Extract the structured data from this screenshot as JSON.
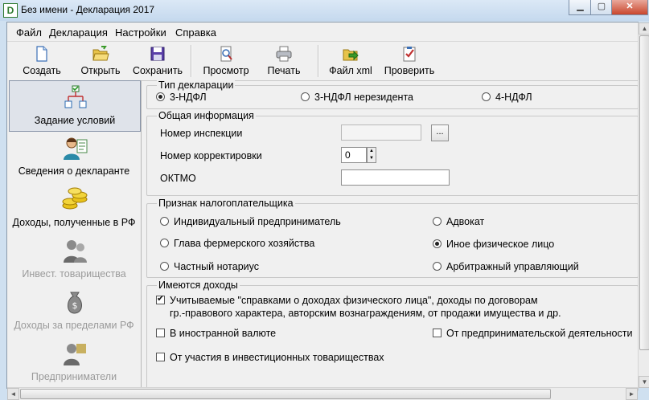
{
  "window": {
    "title": "Без имени - Декларация 2017",
    "app_icon_letter": "D",
    "controls": {
      "minimize": "▁",
      "maximize": "▢",
      "close": "✕"
    }
  },
  "menu": [
    "Файл",
    "Декларация",
    "Настройки",
    "Справка"
  ],
  "toolbar": [
    {
      "label": "Создать",
      "icon": "new-document-icon"
    },
    {
      "label": "Открыть",
      "icon": "open-folder-icon"
    },
    {
      "label": "Сохранить",
      "icon": "floppy-disk-icon"
    },
    {
      "label": "Просмотр",
      "icon": "preview-icon"
    },
    {
      "label": "Печать",
      "icon": "printer-icon"
    },
    {
      "label": "Файл xml",
      "icon": "xml-file-icon"
    },
    {
      "label": "Проверить",
      "icon": "checklist-icon"
    }
  ],
  "sidebar": [
    {
      "label": "Задание условий",
      "icon": "conditions-flowchart-icon",
      "selected": true,
      "disabled": false
    },
    {
      "label": "Сведения о декларанте",
      "icon": "person-card-icon",
      "selected": false,
      "disabled": false
    },
    {
      "label": "Доходы, полученные в РФ",
      "icon": "gold-coins-icon",
      "selected": false,
      "disabled": false
    },
    {
      "label": "Инвест. товарищества",
      "icon": "handshake-people-icon",
      "selected": false,
      "disabled": true
    },
    {
      "label": "Доходы за пределами РФ",
      "icon": "money-bag-icon",
      "selected": false,
      "disabled": true
    },
    {
      "label": "Предприниматели",
      "icon": "businessman-icon",
      "selected": false,
      "disabled": true
    }
  ],
  "declaration_type": {
    "legend": "Тип декларации",
    "options": [
      {
        "label": "3-НДФЛ",
        "selected": true
      },
      {
        "label": "3-НДФЛ нерезидента",
        "selected": false
      },
      {
        "label": "4-НДФЛ",
        "selected": false
      }
    ]
  },
  "general_info": {
    "legend": "Общая информация",
    "inspection_label": "Номер инспекции",
    "inspection_value": "",
    "browse_button": "...",
    "correction_label": "Номер корректировки",
    "correction_value": "0",
    "oktmo_label": "ОКТМО",
    "oktmo_value": ""
  },
  "taxpayer": {
    "legend": "Признак налогоплательщика",
    "options": [
      {
        "label": "Индивидуальный предприниматель",
        "selected": false
      },
      {
        "label": "Адвокат",
        "selected": false
      },
      {
        "label": "Глава фермерского хозяйства",
        "selected": false
      },
      {
        "label": "Иное физическое лицо",
        "selected": true
      },
      {
        "label": "Частный нотариус",
        "selected": false
      },
      {
        "label": "Арбитражный управляющий",
        "selected": false
      }
    ]
  },
  "incomes": {
    "legend": "Имеются доходы",
    "options": [
      {
        "label": "Учитываемые \"справками о доходах физического лица\", доходы по договорам",
        "label2": "гр.-правового характера, авторским вознаграждениям, от продажи имущества и др.",
        "checked": true
      },
      {
        "label": "В иностранной валюте",
        "checked": false
      },
      {
        "label": "От предпринимательской деятельности",
        "checked": false
      },
      {
        "label": "От участия в инвестиционных товариществах",
        "checked": false
      }
    ]
  },
  "scroll": {
    "up": "▲",
    "down": "▼",
    "left": "◄",
    "right": "►",
    "spin_up": "▲",
    "spin_down": "▼"
  }
}
